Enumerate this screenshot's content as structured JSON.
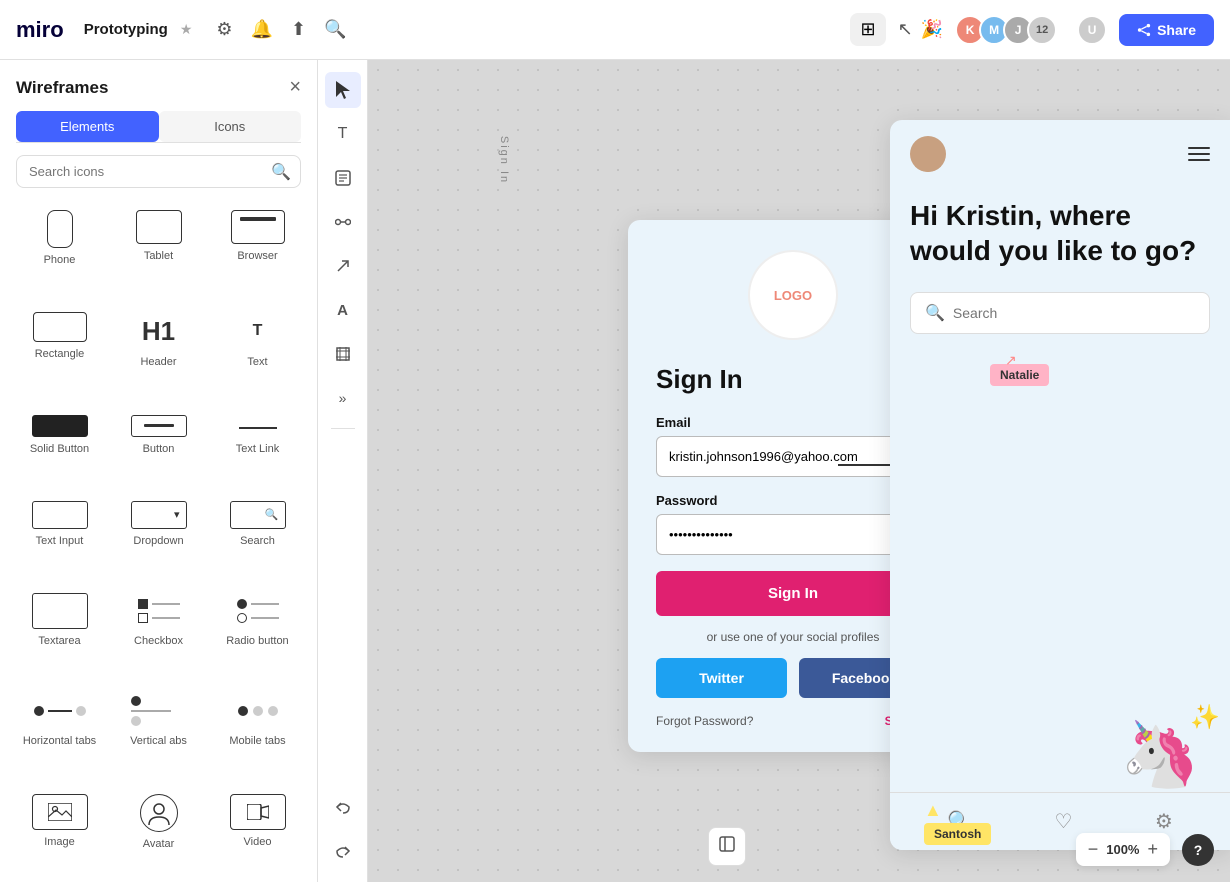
{
  "topbar": {
    "logo": "miro",
    "project_name": "Prototyping",
    "star_symbol": "★",
    "share_label": "Share",
    "zoom_value": "100%",
    "avatar_count": "12"
  },
  "sidebar": {
    "title": "Wireframes",
    "close_symbol": "×",
    "tabs": [
      {
        "label": "Elements",
        "active": true
      },
      {
        "label": "Icons",
        "active": false
      }
    ],
    "search_placeholder": "Search icons",
    "elements": [
      {
        "id": "phone",
        "label": "Phone"
      },
      {
        "id": "tablet",
        "label": "Tablet"
      },
      {
        "id": "browser",
        "label": "Browser"
      },
      {
        "id": "rectangle",
        "label": "Rectangle"
      },
      {
        "id": "header",
        "label": "Header"
      },
      {
        "id": "text",
        "label": "Text"
      },
      {
        "id": "solid-button",
        "label": "Solid Button"
      },
      {
        "id": "button",
        "label": "Button"
      },
      {
        "id": "text-link",
        "label": "Text Link"
      },
      {
        "id": "text-input",
        "label": "Text Input"
      },
      {
        "id": "dropdown",
        "label": "Dropdown"
      },
      {
        "id": "search",
        "label": "Search"
      },
      {
        "id": "textarea",
        "label": "Textarea"
      },
      {
        "id": "checkbox",
        "label": "Checkbox"
      },
      {
        "id": "radio-button",
        "label": "Radio button"
      },
      {
        "id": "horizontal-tabs",
        "label": "Horizontal tabs"
      },
      {
        "id": "vertical-tabs",
        "label": "Vertical abs"
      },
      {
        "id": "mobile-tabs",
        "label": "Mobile tabs"
      },
      {
        "id": "image",
        "label": "Image"
      },
      {
        "id": "avatar",
        "label": "Avatar"
      },
      {
        "id": "video",
        "label": "Video"
      }
    ]
  },
  "wireframe_phone": {
    "logo_text": "LOGO",
    "title": "Sign In",
    "email_label": "Email",
    "email_value": "kristin.johnson1996@yahoo.com",
    "password_label": "Password",
    "password_value": "••••••••••••••",
    "signin_btn": "Sign In",
    "social_text": "or use one of your social profiles",
    "twitter_btn": "Twitter",
    "facebook_btn": "Facebook",
    "forgot_text": "Forgot Password?",
    "signup_text": "Sign Up"
  },
  "wireframe_desktop": {
    "heading": "Hi Kristin, where would you like to go?",
    "search_placeholder": "Search"
  },
  "stickies": {
    "santosh": "Santosh",
    "natalie": "Natalie"
  },
  "zoom": {
    "minus": "−",
    "value": "100%",
    "plus": "+"
  },
  "tools": {
    "cursor": "▲",
    "text": "T",
    "note": "▭",
    "connect": "⌖",
    "arrow": "↗",
    "font": "A",
    "frame": "#",
    "more": "»",
    "undo": "↩",
    "redo": "↪"
  }
}
